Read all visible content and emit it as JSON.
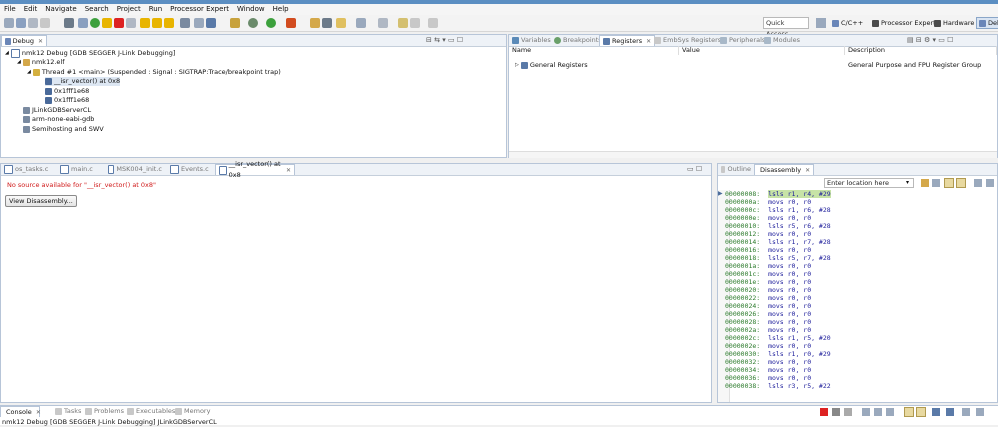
{
  "menubar": [
    "File",
    "Edit",
    "Navigate",
    "Search",
    "Project",
    "Run",
    "Processor Expert",
    "Window",
    "Help"
  ],
  "toolbar": {
    "quick_access": "Quick Access",
    "perspectives": [
      "C/C++",
      "Processor Expert",
      "Hardware",
      "Deb"
    ]
  },
  "debug_view": {
    "tab": "Debug",
    "tree": [
      {
        "label": "nmk12 Debug [GDB SEGGER J-Link Debugging]",
        "level": 0
      },
      {
        "label": "nmk12.elf",
        "level": 1
      },
      {
        "label": "Thread #1 <main> (Suspended : Signal : SIGTRAP:Trace/breakpoint trap)",
        "level": 2
      },
      {
        "label": "__isr_vector() at 0x8",
        "level": 3
      },
      {
        "label": "0x1fff1e68",
        "level": 3
      },
      {
        "label": "0x1fff1e68",
        "level": 3
      },
      {
        "label": "JLinkGDBServerCL",
        "level": 1
      },
      {
        "label": "arm-none-eabi-gdb",
        "level": 1
      },
      {
        "label": "Semihosting and SWV",
        "level": 1
      }
    ]
  },
  "registers_view": {
    "tabs": [
      "Variables",
      "Breakpoints",
      "Registers",
      "EmbSys Registers",
      "Peripherals",
      "Modules"
    ],
    "active_tab": "Registers",
    "columns": [
      "Name",
      "Value",
      "Description"
    ],
    "rows": [
      {
        "name": "General Registers",
        "value": "",
        "description": "General Purpose and FPU Register Group"
      }
    ]
  },
  "editor": {
    "tabs": [
      "os_tasks.c",
      "main.c",
      "MSK004_init.c",
      "Events.c",
      "__isr_vector() at 0x8"
    ],
    "active_tab": "__isr_vector() at 0x8",
    "message": "No source available for \"__isr_vector() at 0x8\"",
    "button": "View Disassembly..."
  },
  "disassembly_view": {
    "tabs": [
      "Outline",
      "Disassembly"
    ],
    "active_tab": "Disassembly",
    "location_placeholder": "Enter location here",
    "lines": [
      {
        "addr": "00000008:",
        "instr": "lsls r1, r4, #29",
        "current": true
      },
      {
        "addr": "0000000a:",
        "instr": "movs r0, r0"
      },
      {
        "addr": "0000000c:",
        "instr": "lsls r1, r6, #28"
      },
      {
        "addr": "0000000e:",
        "instr": "movs r0, r0"
      },
      {
        "addr": "00000010:",
        "instr": "lsls r5, r6, #28"
      },
      {
        "addr": "00000012:",
        "instr": "movs r0, r0"
      },
      {
        "addr": "00000014:",
        "instr": "lsls r1, r7, #28"
      },
      {
        "addr": "00000016:",
        "instr": "movs r0, r0"
      },
      {
        "addr": "00000018:",
        "instr": "lsls r5, r7, #28"
      },
      {
        "addr": "0000001a:",
        "instr": "movs r0, r0"
      },
      {
        "addr": "0000001c:",
        "instr": "movs r0, r0"
      },
      {
        "addr": "0000001e:",
        "instr": "movs r0, r0"
      },
      {
        "addr": "00000020:",
        "instr": "movs r0, r0"
      },
      {
        "addr": "00000022:",
        "instr": "movs r0, r0"
      },
      {
        "addr": "00000024:",
        "instr": "movs r0, r0"
      },
      {
        "addr": "00000026:",
        "instr": "movs r0, r0"
      },
      {
        "addr": "00000028:",
        "instr": "movs r0, r0"
      },
      {
        "addr": "0000002a:",
        "instr": "movs r0, r0"
      },
      {
        "addr": "0000002c:",
        "instr": "lsls r1, r5, #20"
      },
      {
        "addr": "0000002e:",
        "instr": "movs r0, r0"
      },
      {
        "addr": "00000030:",
        "instr": "lsls r1, r0, #29"
      },
      {
        "addr": "00000032:",
        "instr": "movs r0, r0"
      },
      {
        "addr": "00000034:",
        "instr": "movs r0, r0"
      },
      {
        "addr": "00000036:",
        "instr": "movs r0, r0"
      },
      {
        "addr": "00000038:",
        "instr": "lsls r3, r5, #22"
      }
    ]
  },
  "console_view": {
    "tabs": [
      "Console",
      "Tasks",
      "Problems",
      "Executables",
      "Memory"
    ],
    "active_tab": "Console",
    "line": "nmk12 Debug [GDB SEGGER J-Link Debugging] JLinkGDBServerCL"
  },
  "colors": {
    "accent": "#5b8ec2",
    "error_text": "#d01a1a",
    "address": "#2a7a2a",
    "instruction": "#1b1b9a",
    "current_line": "#c7e3a6"
  }
}
